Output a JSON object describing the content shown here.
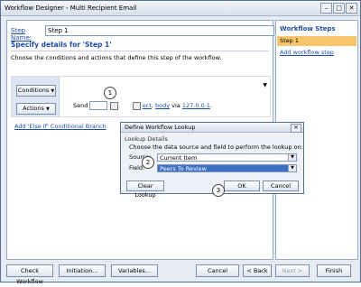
{
  "window": {
    "title": "Workflow Designer - Multi Recipient Email",
    "controls": [
      "–",
      "□",
      "✕"
    ]
  },
  "step_name": {
    "label": "Step Name:",
    "value": "Step 1"
  },
  "details": {
    "header": "Specify details for 'Step 1'",
    "description": "Choose the conditions and actions that define this step of the workflow.",
    "conditions_label": "Conditions",
    "actions_label": "Actions",
    "action_send": "Send",
    "action_subject_link": "ect",
    "action_sep1": ",",
    "action_body_link": "body",
    "action_via": "via",
    "action_server_link": "127.0.0.1",
    "action_end": ".",
    "add_else": "Add 'Else If' Conditional Branch"
  },
  "sidebar": {
    "title": "Workflow Steps",
    "step": "Step 1",
    "add": "Add workflow step"
  },
  "dialog": {
    "title": "Define Workflow Lookup",
    "group_label": "Lookup Details",
    "instruction": "Choose the data source and field to perform the lookup on:",
    "source_label": "Source:",
    "source_value": "Current Item",
    "field_label": "Field:",
    "field_value": "Peers To Review",
    "clear_label": "Clear Lookup",
    "ok_label": "OK",
    "cancel_label": "Cancel"
  },
  "bottom": {
    "check": "Check Workflow",
    "initiation": "Initiation...",
    "variables": "Variables...",
    "cancel": "Cancel",
    "back": "< Back",
    "next": "Next >",
    "finish": "Finish"
  },
  "callouts": [
    "1",
    "2",
    "3"
  ],
  "icons": {
    "dropdown": "▼",
    "close": "✕"
  }
}
